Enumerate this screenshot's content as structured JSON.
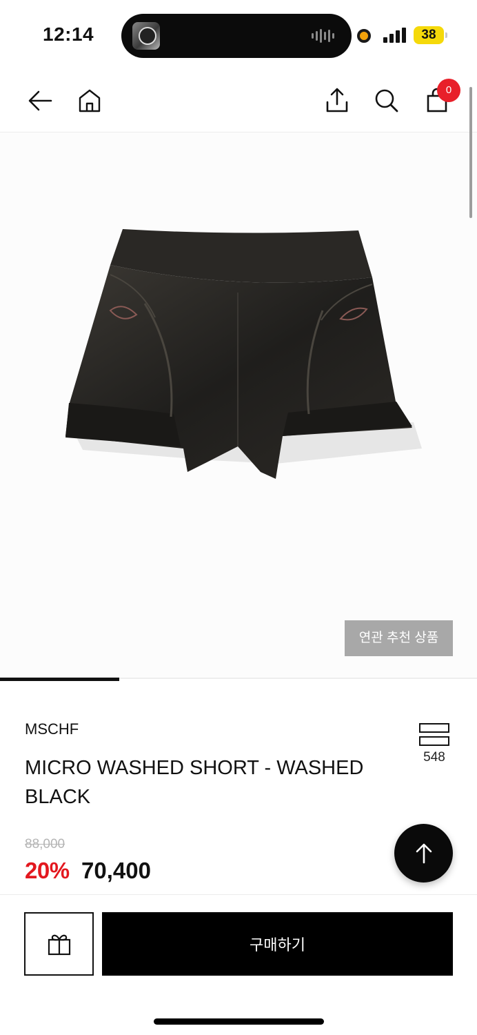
{
  "status_bar": {
    "time": "12:14",
    "battery": "38",
    "battery_color": "#f5d90a"
  },
  "nav": {
    "back_icon": "arrow-left-icon",
    "home_icon": "home-icon",
    "share_icon": "share-icon",
    "search_icon": "search-icon",
    "cart_icon": "shopping-bag-icon",
    "cart_count": "0"
  },
  "gallery": {
    "related_label": "연관 추천 상품",
    "progress": 0.25
  },
  "product": {
    "brand": "MSCHF",
    "name": "MICRO WASHED SHORT - WASHED BLACK",
    "compare_count": "548",
    "original_price": "88,000",
    "discount": "20%",
    "sale_price": "70,400"
  },
  "actions": {
    "buy_label": "구매하기",
    "gift_icon": "gift-icon",
    "scroll_top_icon": "arrow-up-icon"
  },
  "colors": {
    "discount": "#e3181f",
    "badge": "#e8202a",
    "primary": "#000000"
  }
}
